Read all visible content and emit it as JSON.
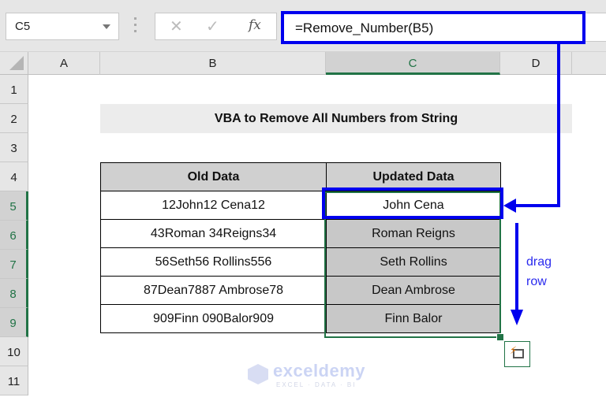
{
  "toolbar": {
    "name_box": "C5",
    "cancel_icon": "✕",
    "enter_icon": "✓",
    "fx_label": "fx",
    "formula": "=Remove_Number(B5)"
  },
  "columns": [
    "A",
    "B",
    "C",
    "D"
  ],
  "selected_column": "C",
  "rows": [
    "1",
    "2",
    "3",
    "4",
    "5",
    "6",
    "7",
    "8",
    "9",
    "10",
    "11"
  ],
  "selected_rows": [
    "5",
    "6",
    "7",
    "8",
    "9"
  ],
  "sheet": {
    "title": "VBA to Remove All Numbers from String",
    "table": {
      "headers": [
        "Old Data",
        "Updated Data"
      ],
      "rows": [
        [
          "12John12 Cena12",
          "John Cena"
        ],
        [
          "43Roman 34Reigns34",
          "Roman Reigns"
        ],
        [
          "56Seth56 Rollins556",
          "Seth Rollins"
        ],
        [
          "87Dean7887 Ambrose78",
          "Dean Ambrose"
        ],
        [
          "909Finn 090Balor909",
          "Finn Balor"
        ]
      ]
    }
  },
  "annotations": {
    "drag_label_line1": "drag",
    "drag_label_line2": "row",
    "arrow_color": "#0000ee"
  },
  "autofill_icon": "⚡",
  "watermark": {
    "name": "exceldemy",
    "tagline": "EXCEL · DATA · BI"
  },
  "colors": {
    "selection_green": "#217346",
    "header_gray": "#e6e6e6",
    "filled_cell_gray": "#c8c8c8"
  }
}
